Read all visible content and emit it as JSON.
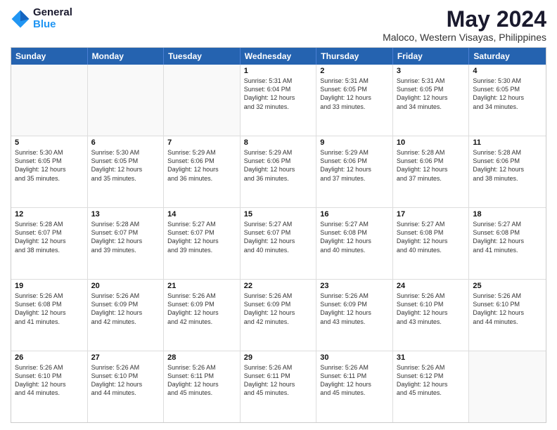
{
  "logo": {
    "line1": "General",
    "line2": "Blue"
  },
  "title": "May 2024",
  "subtitle": "Maloco, Western Visayas, Philippines",
  "header_days": [
    "Sunday",
    "Monday",
    "Tuesday",
    "Wednesday",
    "Thursday",
    "Friday",
    "Saturday"
  ],
  "weeks": [
    [
      {
        "day": "",
        "info": "",
        "empty": true
      },
      {
        "day": "",
        "info": "",
        "empty": true
      },
      {
        "day": "",
        "info": "",
        "empty": true
      },
      {
        "day": "1",
        "info": "Sunrise: 5:31 AM\nSunset: 6:04 PM\nDaylight: 12 hours\nand 32 minutes.",
        "empty": false
      },
      {
        "day": "2",
        "info": "Sunrise: 5:31 AM\nSunset: 6:05 PM\nDaylight: 12 hours\nand 33 minutes.",
        "empty": false
      },
      {
        "day": "3",
        "info": "Sunrise: 5:31 AM\nSunset: 6:05 PM\nDaylight: 12 hours\nand 34 minutes.",
        "empty": false
      },
      {
        "day": "4",
        "info": "Sunrise: 5:30 AM\nSunset: 6:05 PM\nDaylight: 12 hours\nand 34 minutes.",
        "empty": false
      }
    ],
    [
      {
        "day": "5",
        "info": "Sunrise: 5:30 AM\nSunset: 6:05 PM\nDaylight: 12 hours\nand 35 minutes.",
        "empty": false
      },
      {
        "day": "6",
        "info": "Sunrise: 5:30 AM\nSunset: 6:05 PM\nDaylight: 12 hours\nand 35 minutes.",
        "empty": false
      },
      {
        "day": "7",
        "info": "Sunrise: 5:29 AM\nSunset: 6:06 PM\nDaylight: 12 hours\nand 36 minutes.",
        "empty": false
      },
      {
        "day": "8",
        "info": "Sunrise: 5:29 AM\nSunset: 6:06 PM\nDaylight: 12 hours\nand 36 minutes.",
        "empty": false
      },
      {
        "day": "9",
        "info": "Sunrise: 5:29 AM\nSunset: 6:06 PM\nDaylight: 12 hours\nand 37 minutes.",
        "empty": false
      },
      {
        "day": "10",
        "info": "Sunrise: 5:28 AM\nSunset: 6:06 PM\nDaylight: 12 hours\nand 37 minutes.",
        "empty": false
      },
      {
        "day": "11",
        "info": "Sunrise: 5:28 AM\nSunset: 6:06 PM\nDaylight: 12 hours\nand 38 minutes.",
        "empty": false
      }
    ],
    [
      {
        "day": "12",
        "info": "Sunrise: 5:28 AM\nSunset: 6:07 PM\nDaylight: 12 hours\nand 38 minutes.",
        "empty": false
      },
      {
        "day": "13",
        "info": "Sunrise: 5:28 AM\nSunset: 6:07 PM\nDaylight: 12 hours\nand 39 minutes.",
        "empty": false
      },
      {
        "day": "14",
        "info": "Sunrise: 5:27 AM\nSunset: 6:07 PM\nDaylight: 12 hours\nand 39 minutes.",
        "empty": false
      },
      {
        "day": "15",
        "info": "Sunrise: 5:27 AM\nSunset: 6:07 PM\nDaylight: 12 hours\nand 40 minutes.",
        "empty": false
      },
      {
        "day": "16",
        "info": "Sunrise: 5:27 AM\nSunset: 6:08 PM\nDaylight: 12 hours\nand 40 minutes.",
        "empty": false
      },
      {
        "day": "17",
        "info": "Sunrise: 5:27 AM\nSunset: 6:08 PM\nDaylight: 12 hours\nand 40 minutes.",
        "empty": false
      },
      {
        "day": "18",
        "info": "Sunrise: 5:27 AM\nSunset: 6:08 PM\nDaylight: 12 hours\nand 41 minutes.",
        "empty": false
      }
    ],
    [
      {
        "day": "19",
        "info": "Sunrise: 5:26 AM\nSunset: 6:08 PM\nDaylight: 12 hours\nand 41 minutes.",
        "empty": false
      },
      {
        "day": "20",
        "info": "Sunrise: 5:26 AM\nSunset: 6:09 PM\nDaylight: 12 hours\nand 42 minutes.",
        "empty": false
      },
      {
        "day": "21",
        "info": "Sunrise: 5:26 AM\nSunset: 6:09 PM\nDaylight: 12 hours\nand 42 minutes.",
        "empty": false
      },
      {
        "day": "22",
        "info": "Sunrise: 5:26 AM\nSunset: 6:09 PM\nDaylight: 12 hours\nand 42 minutes.",
        "empty": false
      },
      {
        "day": "23",
        "info": "Sunrise: 5:26 AM\nSunset: 6:09 PM\nDaylight: 12 hours\nand 43 minutes.",
        "empty": false
      },
      {
        "day": "24",
        "info": "Sunrise: 5:26 AM\nSunset: 6:10 PM\nDaylight: 12 hours\nand 43 minutes.",
        "empty": false
      },
      {
        "day": "25",
        "info": "Sunrise: 5:26 AM\nSunset: 6:10 PM\nDaylight: 12 hours\nand 44 minutes.",
        "empty": false
      }
    ],
    [
      {
        "day": "26",
        "info": "Sunrise: 5:26 AM\nSunset: 6:10 PM\nDaylight: 12 hours\nand 44 minutes.",
        "empty": false
      },
      {
        "day": "27",
        "info": "Sunrise: 5:26 AM\nSunset: 6:10 PM\nDaylight: 12 hours\nand 44 minutes.",
        "empty": false
      },
      {
        "day": "28",
        "info": "Sunrise: 5:26 AM\nSunset: 6:11 PM\nDaylight: 12 hours\nand 45 minutes.",
        "empty": false
      },
      {
        "day": "29",
        "info": "Sunrise: 5:26 AM\nSunset: 6:11 PM\nDaylight: 12 hours\nand 45 minutes.",
        "empty": false
      },
      {
        "day": "30",
        "info": "Sunrise: 5:26 AM\nSunset: 6:11 PM\nDaylight: 12 hours\nand 45 minutes.",
        "empty": false
      },
      {
        "day": "31",
        "info": "Sunrise: 5:26 AM\nSunset: 6:12 PM\nDaylight: 12 hours\nand 45 minutes.",
        "empty": false
      },
      {
        "day": "",
        "info": "",
        "empty": true
      }
    ]
  ]
}
